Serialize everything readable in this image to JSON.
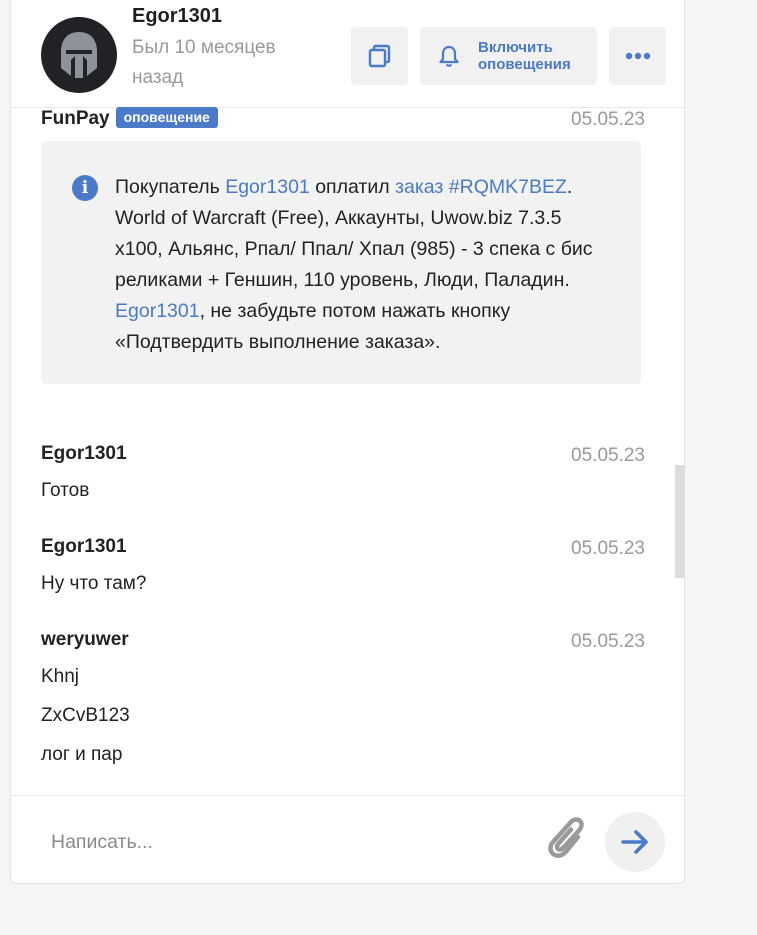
{
  "header": {
    "username": "Egor1301",
    "status": "Был 10 месяцев назад",
    "notify_label": "Включить оповещения"
  },
  "messages": {
    "system": {
      "author": "FunPay",
      "badge": "оповещение",
      "date": "05.05.23",
      "t1": "Покупатель ",
      "buyer_link": "Egor1301",
      "t2": " оплатил ",
      "order_link": "заказ #RQMK7BEZ",
      "t3": ". World of Warcraft (Free), Аккаунты, Uwow.biz 7.3.5 x100, Альянс, Рпал/ Ппал/ Хпал (985) - 3 спека с бис реликами + Геншин, 110 уровень, Люди, Паладин.",
      "user_link": "Egor1301",
      "t4": ", не забудьте потом нажать кнопку «Подтвердить выполнение заказа»."
    },
    "m1": {
      "author": "Egor1301",
      "date": "05.05.23",
      "text": "Готов"
    },
    "m2": {
      "author": "Egor1301",
      "date": "05.05.23",
      "text": "Ну что там?"
    },
    "m3": {
      "author": "weryuwer",
      "date": "05.05.23",
      "lines": [
        "Khnj",
        "ZxCvB123",
        "лог и пар"
      ]
    }
  },
  "composer": {
    "placeholder": "Написать..."
  },
  "colors": {
    "accent": "#4a7ac8",
    "muted": "#9a9a9a",
    "panel_bg": "#f2f2f2"
  }
}
